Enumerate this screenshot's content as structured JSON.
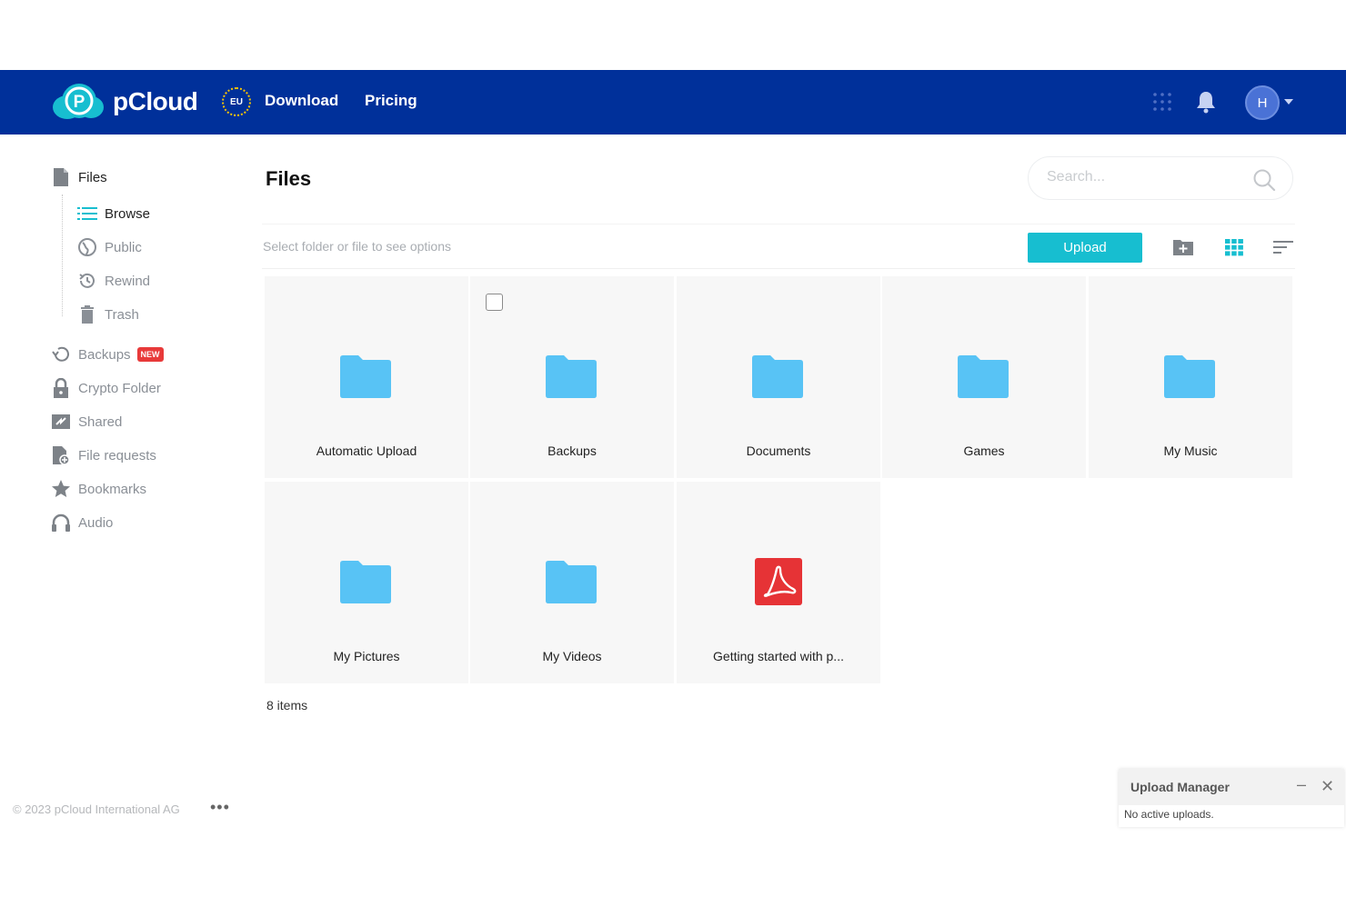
{
  "header": {
    "brand": "pCloud",
    "region_badge": "EU",
    "nav": {
      "download": "Download",
      "pricing": "Pricing"
    },
    "avatar_initial": "H"
  },
  "sidebar": {
    "files": "Files",
    "sub": {
      "browse": "Browse",
      "public": "Public",
      "rewind": "Rewind",
      "trash": "Trash"
    },
    "backups": "Backups",
    "new_badge": "NEW",
    "crypto": "Crypto Folder",
    "shared": "Shared",
    "file_requests": "File requests",
    "bookmarks": "Bookmarks",
    "audio": "Audio",
    "footer": "© 2023 pCloud International AG",
    "more": "•••"
  },
  "main": {
    "title": "Files",
    "search_placeholder": "Search...",
    "toolbar_hint": "Select folder or file to see options",
    "upload_label": "Upload",
    "items": [
      {
        "name": "Automatic Upload",
        "type": "folder"
      },
      {
        "name": "Backups",
        "type": "folder"
      },
      {
        "name": "Documents",
        "type": "folder"
      },
      {
        "name": "Games",
        "type": "folder"
      },
      {
        "name": "My Music",
        "type": "folder"
      },
      {
        "name": "My Pictures",
        "type": "folder"
      },
      {
        "name": "My Videos",
        "type": "folder"
      },
      {
        "name": "Getting started with p...",
        "type": "pdf"
      }
    ],
    "items_count": "8 items"
  },
  "upload_manager": {
    "title": "Upload Manager",
    "status": "No active uploads."
  },
  "colors": {
    "header_bg": "#00309a",
    "accent": "#17bed0",
    "folder": "#58c3f5",
    "pdf": "#e63336"
  }
}
